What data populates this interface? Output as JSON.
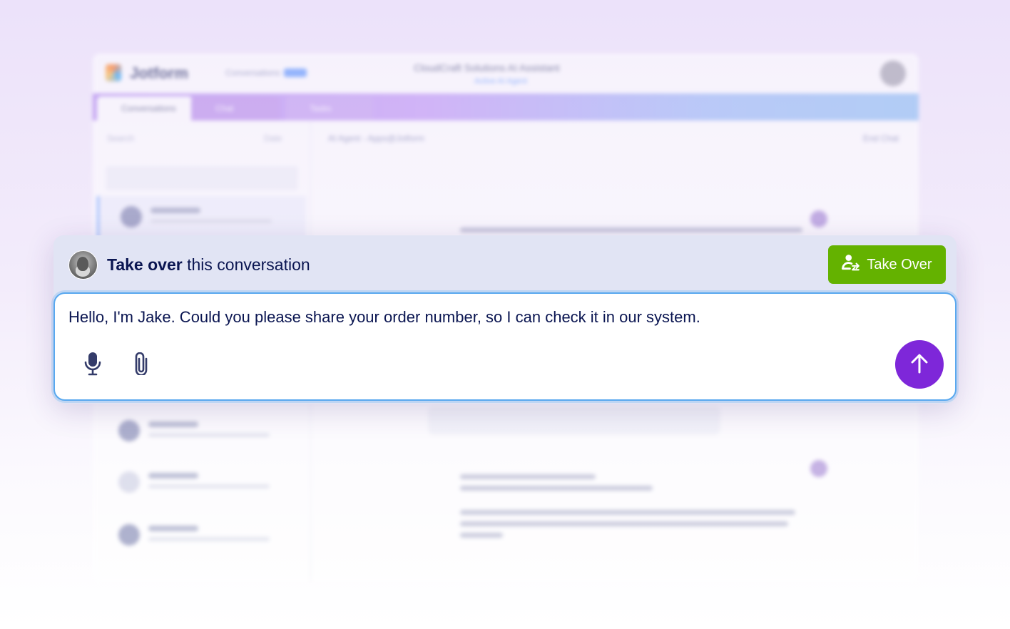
{
  "background_app": {
    "logo": "Jotform",
    "breadcrumb": "Conversations",
    "center_title": "CloudCraft Solutions AI Assistant",
    "center_subtitle": "Active AI Agent",
    "tabs": [
      "Conversations",
      "Chat",
      "Tasks"
    ],
    "search_placeholder": "Search",
    "filter_label": "Date",
    "conversation_header": "AI Agent - Apps@Jotform",
    "end_chat_label": "End Chat"
  },
  "takeover": {
    "title_strong": "Take over",
    "title_rest": " this conversation",
    "button_label": "Take Over",
    "button_color": "#64b200"
  },
  "composer": {
    "message": "Hello, I'm Jake. Could you please share your order number, so I can check it in our system.",
    "mic_icon": "microphone-icon",
    "attach_icon": "paperclip-icon",
    "send_icon": "arrow-up-icon",
    "send_color": "#7e27d9",
    "border_color": "#59a8ef"
  }
}
